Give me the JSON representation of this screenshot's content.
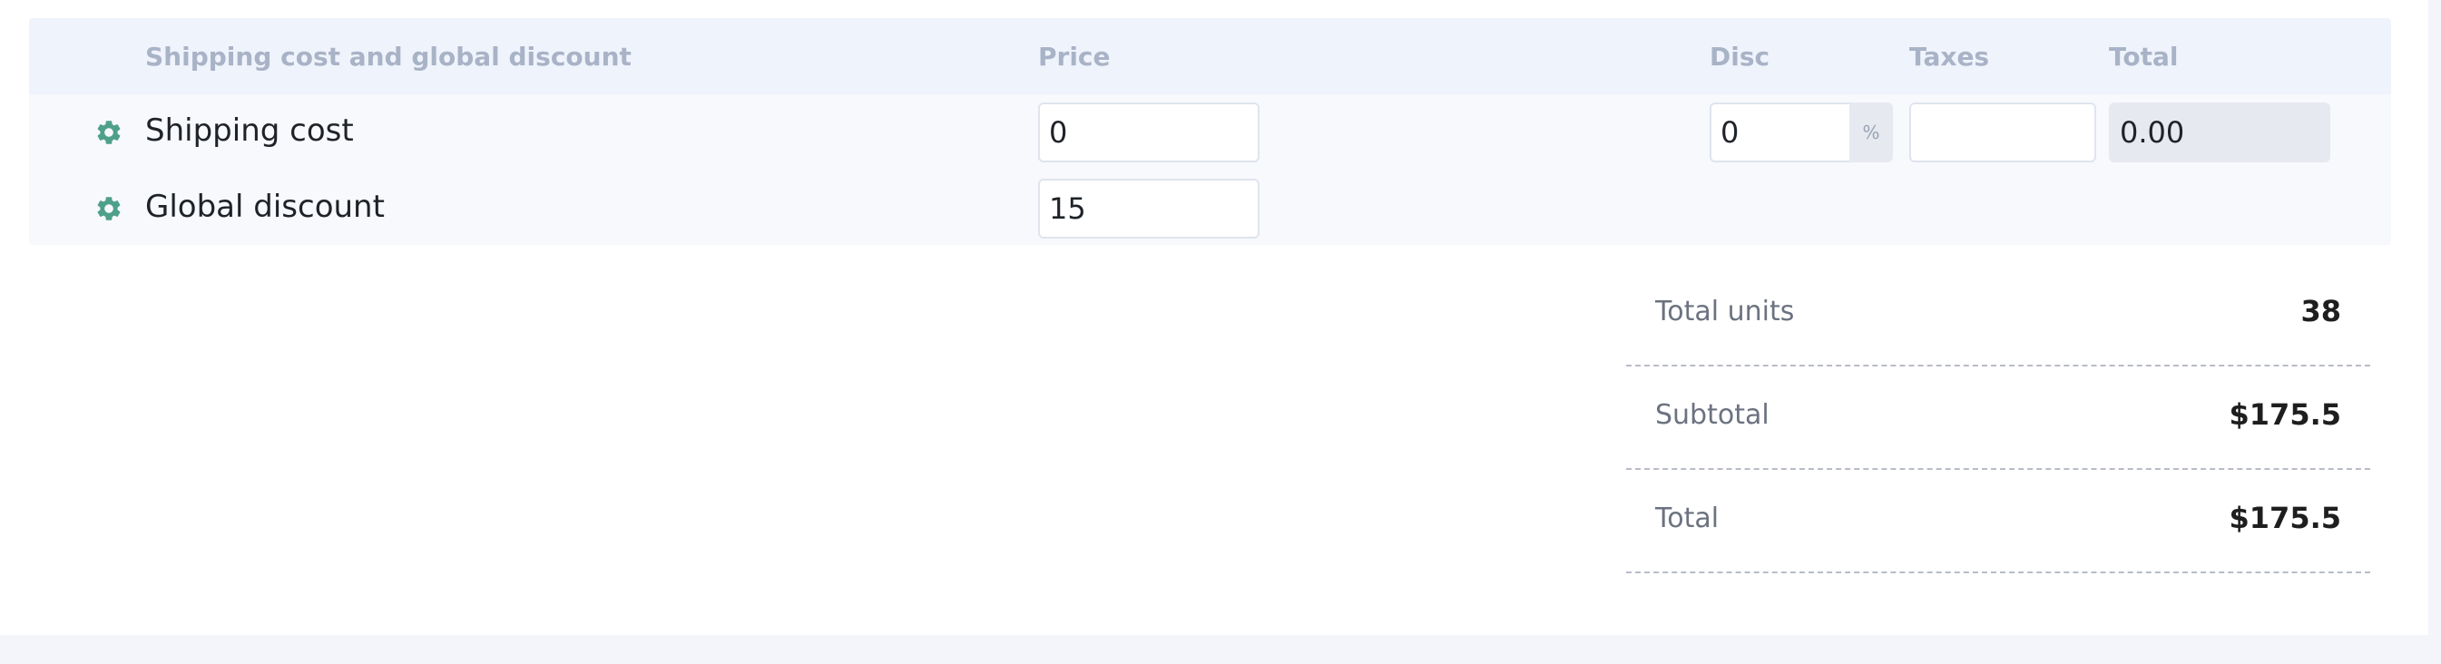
{
  "header": {
    "section_title": "Shipping cost and global discount",
    "price": "Price",
    "disc": "Disc",
    "taxes": "Taxes",
    "total": "Total"
  },
  "rows": [
    {
      "icon": "gear-icon",
      "label": "Shipping cost",
      "price": "0",
      "disc": "0",
      "disc_suffix": "%",
      "taxes": "",
      "total": "0.00"
    },
    {
      "icon": "gear-icon",
      "label": "Global discount",
      "price": "15"
    }
  ],
  "summary": {
    "total_units_label": "Total units",
    "total_units_value": "38",
    "subtotal_label": "Subtotal",
    "subtotal_value": "$175.5",
    "total_label": "Total",
    "total_value": "$175.5"
  },
  "colors": {
    "icon_accent": "#4fa08b",
    "header_text": "#a9b3c7",
    "header_background": "#eff3fb"
  }
}
